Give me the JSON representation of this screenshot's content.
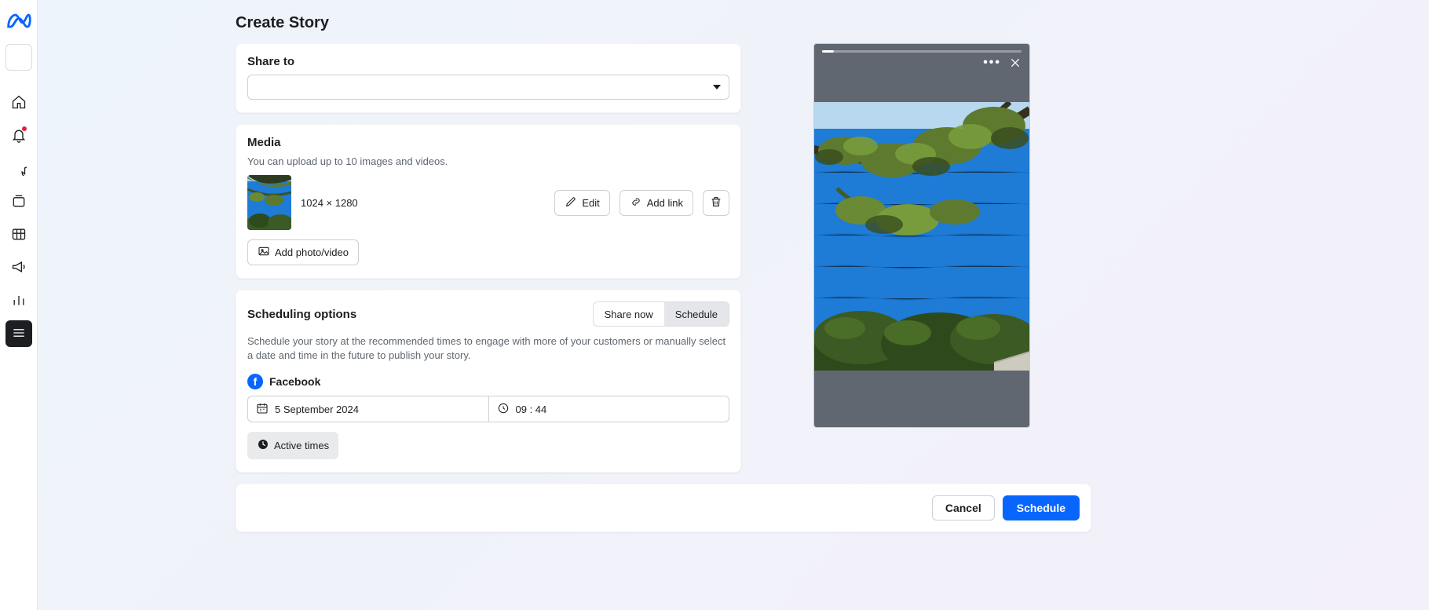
{
  "page": {
    "title": "Create Story"
  },
  "share_to": {
    "heading": "Share to"
  },
  "media": {
    "heading": "Media",
    "description": "You can upload up to 10 images and videos.",
    "dimensions": "1024 × 1280",
    "edit_label": "Edit",
    "add_link_label": "Add link",
    "add_media_label": "Add photo/video"
  },
  "scheduling": {
    "heading": "Scheduling options",
    "share_now_label": "Share now",
    "schedule_label": "Schedule",
    "description": "Schedule your story at the recommended times to engage with more of your customers or manually select a date and time in the future to publish your story.",
    "platform_label": "Facebook",
    "date_value": "5 September 2024",
    "time_value": "09 : 44",
    "active_times_label": "Active times"
  },
  "footer": {
    "cancel_label": "Cancel",
    "submit_label": "Schedule"
  }
}
